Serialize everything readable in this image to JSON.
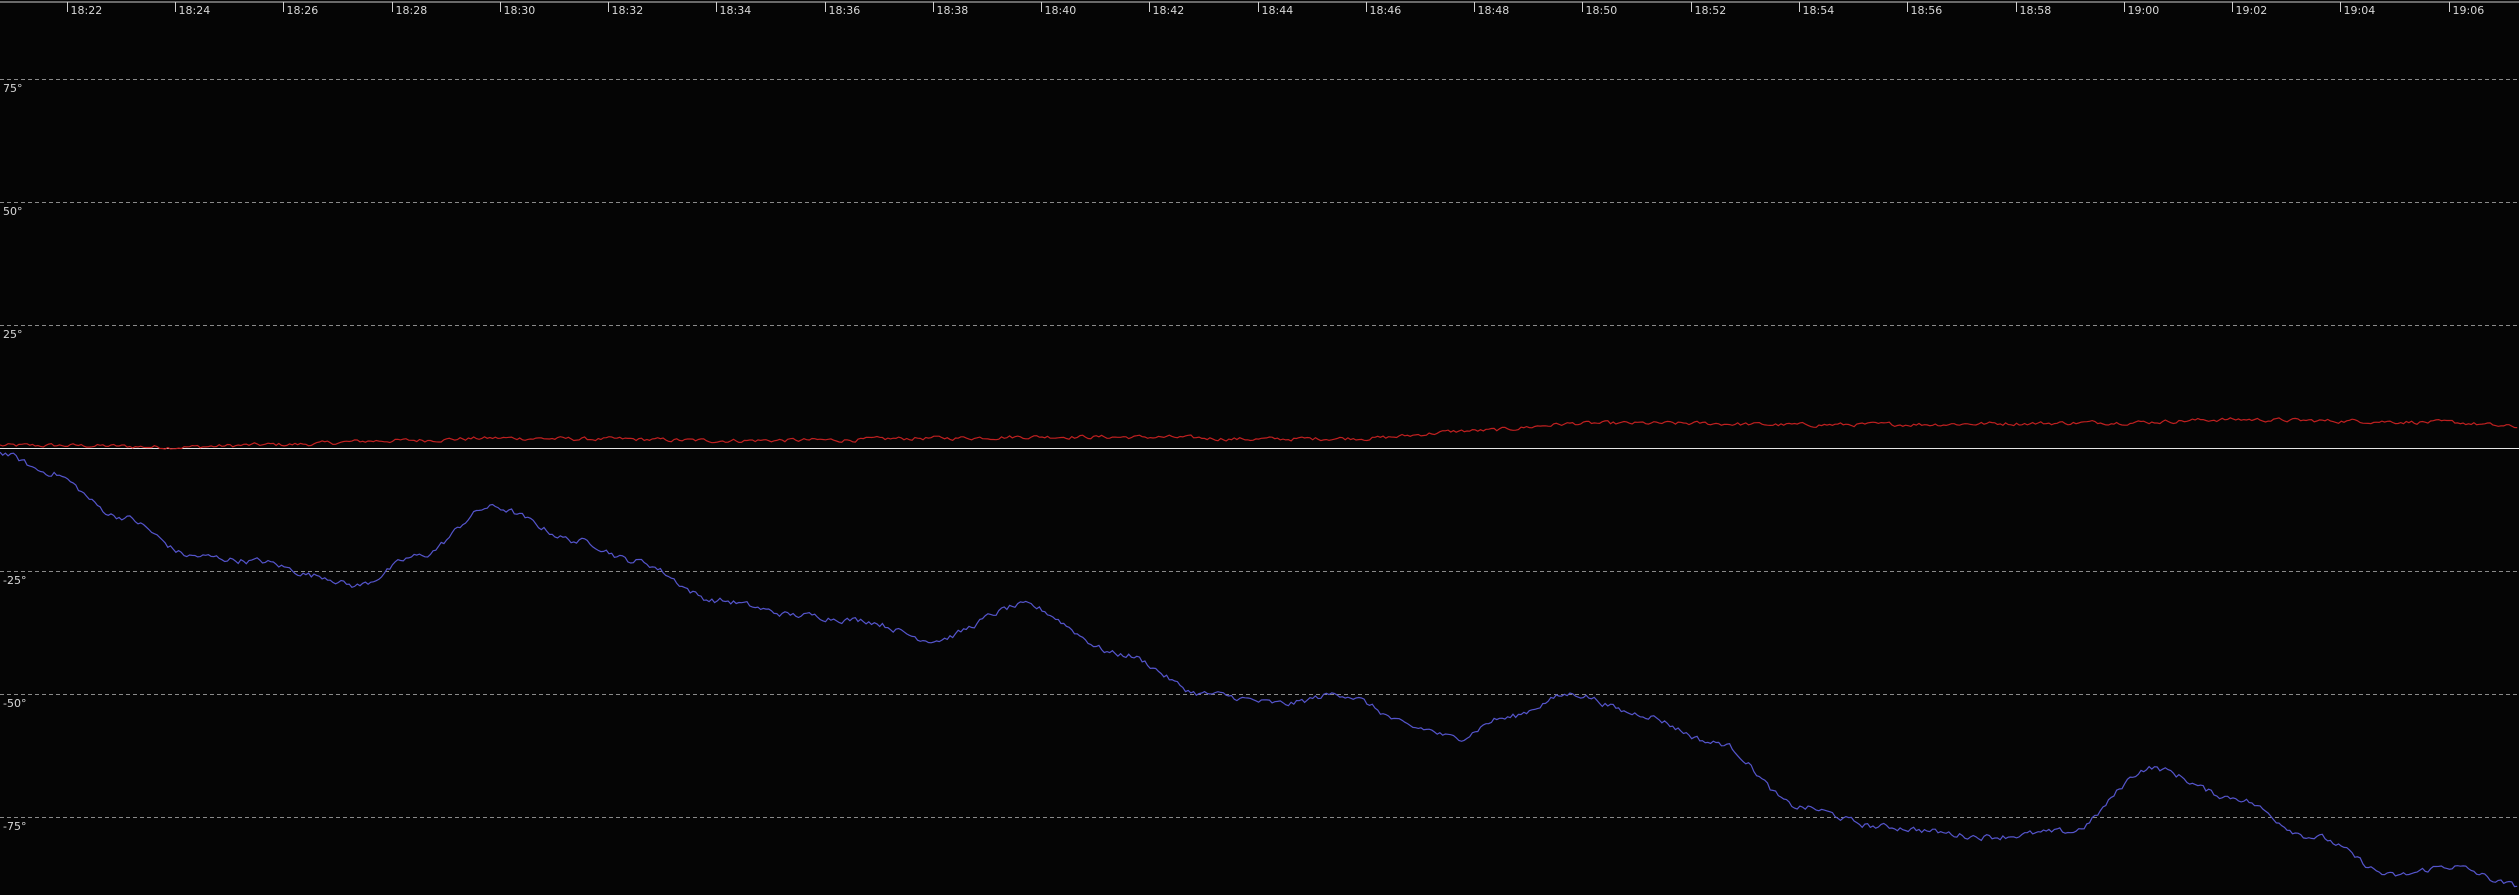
{
  "chart_data": {
    "type": "line",
    "title": "",
    "xlabel": "",
    "ylabel": "",
    "x_tick_labels": [
      "18:22",
      "18:24",
      "18:26",
      "18:28",
      "18:30",
      "18:32",
      "18:34",
      "18:36",
      "18:38",
      "18:40",
      "18:42",
      "18:44",
      "18:46",
      "18:48",
      "18:50",
      "18:52",
      "18:54",
      "18:56",
      "18:58",
      "19:00",
      "19:02",
      "19:04",
      "19:06"
    ],
    "xlim": [
      "18:20:46",
      "19:07:18"
    ],
    "y_ticks": [
      {
        "value": 75,
        "label": "75°"
      },
      {
        "value": 50,
        "label": "50°"
      },
      {
        "value": 25,
        "label": "25°"
      },
      {
        "value": -25,
        "label": "-25°"
      },
      {
        "value": -50,
        "label": "-50°"
      },
      {
        "value": -75,
        "label": "-75°"
      }
    ],
    "ylim": [
      -90,
      90
    ],
    "grid": true,
    "zero_line": true,
    "series": [
      {
        "color": "#c02020",
        "x": [
          "18:20:46",
          "18:22:00",
          "18:24:00",
          "18:26:00",
          "18:28:00",
          "18:30:00",
          "18:32:00",
          "18:34:00",
          "18:36:00",
          "18:38:00",
          "18:40:00",
          "18:42:00",
          "18:44:00",
          "18:46:00",
          "18:48:00",
          "18:50:00",
          "18:52:00",
          "18:54:00",
          "18:56:00",
          "18:58:00",
          "19:00:00",
          "19:02:00",
          "19:04:00",
          "19:06:00",
          "19:07:18"
        ],
        "values": [
          0.5,
          0.5,
          0.2,
          0.7,
          1.5,
          2.0,
          1.8,
          1.5,
          1.6,
          2.0,
          2.3,
          2.2,
          1.8,
          2.0,
          3.5,
          5.0,
          5.0,
          4.7,
          4.8,
          5.0,
          5.2,
          5.8,
          5.5,
          5.2,
          4.3
        ]
      },
      {
        "color": "#5555cc",
        "x": [
          "18:20:46",
          "18:21:40",
          "18:23:00",
          "18:24:20",
          "18:25:30",
          "18:26:40",
          "18:27:20",
          "18:28:30",
          "18:29:50",
          "18:31:30",
          "18:32:30",
          "18:34:00",
          "18:35:30",
          "18:36:40",
          "18:38:00",
          "18:39:40",
          "18:41:30",
          "18:43:00",
          "18:44:30",
          "18:45:30",
          "18:47:00",
          "18:47:40",
          "18:48:30",
          "18:49:50",
          "18:51:00",
          "18:52:30",
          "18:54:00",
          "18:55:30",
          "18:57:30",
          "18:59:00",
          "19:00:30",
          "19:02:00",
          "19:03:30",
          "19:05:00",
          "19:06:00",
          "19:07:18"
        ],
        "values": [
          -1,
          -5,
          -14,
          -22,
          -23,
          -26,
          -28,
          -22,
          -12,
          -19,
          -23,
          -31,
          -34,
          -35,
          -39,
          -32,
          -42,
          -50,
          -52,
          -50,
          -57,
          -59,
          -55,
          -50,
          -54,
          -60,
          -73,
          -77,
          -79,
          -78,
          -65,
          -71,
          -79,
          -87,
          -85,
          -89
        ]
      }
    ]
  }
}
